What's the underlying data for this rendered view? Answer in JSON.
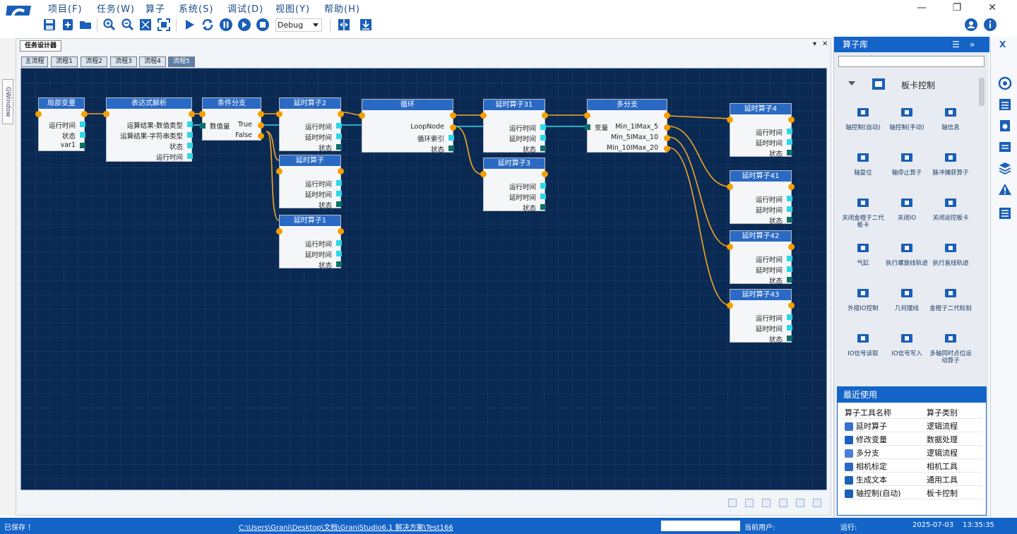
{
  "menu": [
    "项目(F)",
    "任务(W)",
    "算子",
    "系统(S)",
    "调试(D)",
    "视图(Y)",
    "帮助(H)"
  ],
  "window_controls": {
    "minimize": "—",
    "restore": "❐",
    "close": "✕"
  },
  "toolbar": {
    "debug_value": "Debug"
  },
  "gwindow_label": "GWindow",
  "doc_tab": "任务设计器",
  "doc_controls": {
    "dropdown": "▾",
    "close": "✕"
  },
  "flow_tabs": [
    "主流程",
    "流程1",
    "流程2",
    "流程3",
    "流程4",
    "流程5"
  ],
  "active_flow_tab": 5,
  "nodes": [
    {
      "id": "n1",
      "title": "局部变量",
      "rows": [
        "运行时间",
        "状态",
        "var1"
      ]
    },
    {
      "id": "n2",
      "title": "表达式解析",
      "rows": [
        "运算结果-数值类型",
        "运算结果-字符串类型",
        "状态",
        "运行时间"
      ]
    },
    {
      "id": "n3",
      "title": "条件分支",
      "left": "数值量",
      "rows": [
        "True",
        "False"
      ]
    },
    {
      "id": "n4",
      "title": "延时算子2",
      "rows": [
        "运行时间",
        "延时时间",
        "状态"
      ]
    },
    {
      "id": "n5",
      "title": "延时算子",
      "rows": [
        "运行时间",
        "延时时间",
        "状态"
      ]
    },
    {
      "id": "n6",
      "title": "延时算子1",
      "rows": [
        "运行时间",
        "延时时间",
        "状态"
      ]
    },
    {
      "id": "n7",
      "title": "循环",
      "rows": [
        "LoopNode",
        "循环索引",
        "状态"
      ]
    },
    {
      "id": "n8",
      "title": "延时算子31",
      "rows": [
        "运行时间",
        "延时时间",
        "状态"
      ]
    },
    {
      "id": "n9",
      "title": "延时算子3",
      "rows": [
        "运行时间",
        "延时时间",
        "状态"
      ]
    },
    {
      "id": "n10",
      "title": "多分支",
      "left": "变量",
      "rows": [
        "Min_1IMax_5",
        "Min_5IMax_10",
        "Min_10IMax_20"
      ]
    },
    {
      "id": "n11",
      "title": "延时算子4",
      "rows": [
        "运行时间",
        "延时时间",
        "状态"
      ]
    },
    {
      "id": "n12",
      "title": "延时算子41",
      "rows": [
        "运行时间",
        "延时时间",
        "状态"
      ]
    },
    {
      "id": "n13",
      "title": "延时算子42",
      "rows": [
        "运行时间",
        "延时时间",
        "状态"
      ]
    },
    {
      "id": "n14",
      "title": "延时算子43",
      "rows": [
        "运行时间",
        "延时时间",
        "状态"
      ]
    }
  ],
  "operator_library": {
    "title": "算子库",
    "menu_icon": "☰",
    "forward_icon": "»",
    "close": "X",
    "category": "板卡控制",
    "tools": [
      "轴控制(自动)",
      "轴控制(手动)",
      "轴信息",
      "轴复位",
      "轴停止算子",
      "脉冲捕获算子",
      "关闭金橙子二代板卡",
      "关闭IO",
      "关闭运控板卡",
      "气缸",
      "执行螺旋线轨迹",
      "执行直线轨迹",
      "外接IO控制",
      "几何摆线",
      "金橙子二代标刻",
      "IO信号读取",
      "IO信号写入",
      "多轴同时点位运动算子"
    ]
  },
  "recent": {
    "title": "最近使用",
    "headers": [
      "算子工具名称",
      "算子类别"
    ],
    "rows": [
      {
        "name": "延时算子",
        "cat": "逻辑流程"
      },
      {
        "name": "修改变量",
        "cat": "数据处理"
      },
      {
        "name": "多分支",
        "cat": "逻辑流程"
      },
      {
        "name": "相机标定",
        "cat": "相机工具"
      },
      {
        "name": "生成文本",
        "cat": "通用工具"
      },
      {
        "name": "轴控制(自动)",
        "cat": "板卡控制"
      }
    ]
  },
  "status": {
    "saved": "已保存 ！",
    "path": "C:\\Users\\Grani\\Desktop\\文档\\GraniStudio6.1 解决方案\\Test166",
    "user_label": "当前用户:",
    "run_label": "运行:",
    "date": "2025-07-03",
    "time": "13:35:35"
  },
  "colors": {
    "canvas": "#0a2a54",
    "accent": "#1464c8",
    "node_header": "#2a6ac4",
    "wire": "#f5a623",
    "wire_cyan": "#2fd6e8"
  }
}
